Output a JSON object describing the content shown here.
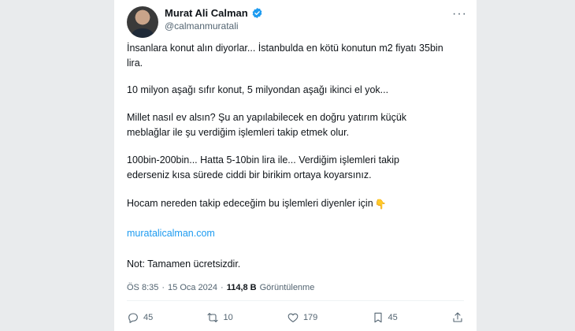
{
  "author": {
    "name": "Murat Ali Calman",
    "handle": "@calmanmuratali",
    "verified_color": "#1d9bf0"
  },
  "tweet": {
    "p1": "İnsanlara konut alın diyorlar... İstanbulda en kötü konutun m2 fiyatı 35bin\nlira.",
    "p2": "10 milyon aşağı sıfır konut, 5 milyondan aşağı ikinci el yok...",
    "p3": "Millet nasıl ev alsın? Şu an yapılabilecek en doğru yatırım küçük\nmeblağlar ile şu verdiğim işlemleri takip etmek olur.",
    "p4": "100bin-200bin... Hatta 5-10bin lira ile... Verdiğim işlemleri takip\nederseniz kısa sürede ciddi bir birikim ortaya koyarsınız.",
    "p5": "Hocam nereden takip edeceğim bu işlemleri diyenler için",
    "p5_emoji": "👇",
    "link": "muratalicalman.com",
    "p7": "Not: Tamamen ücretsizdir."
  },
  "meta": {
    "time": "ÖS 8:35",
    "sep1": "·",
    "date": "15 Oca 2024",
    "sep2": "·",
    "views_count": "114,8 B",
    "views_label": "Görüntülenme"
  },
  "actions": {
    "replies": "45",
    "reposts": "10",
    "likes": "179",
    "bookmarks": "45"
  },
  "icons": [
    "verified-badge-icon",
    "more-icon",
    "reply-icon",
    "repost-icon",
    "like-icon",
    "bookmark-icon",
    "share-icon"
  ]
}
